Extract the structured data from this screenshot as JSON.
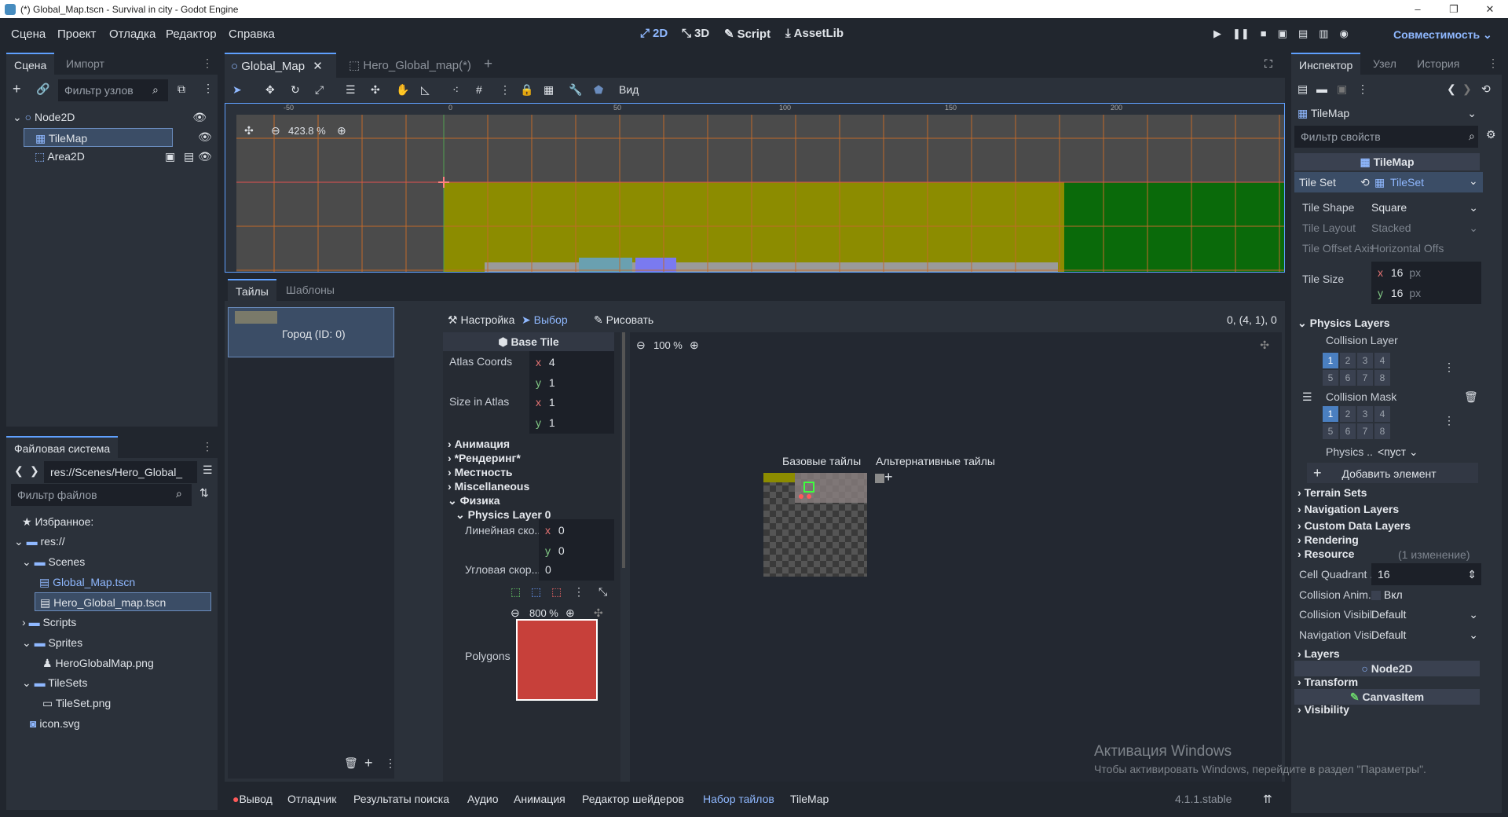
{
  "window": {
    "title": "(*) Global_Map.tscn - Survival in city - Godot Engine",
    "minimize": "–",
    "maximize": "❐",
    "close": "✕"
  },
  "menu": {
    "items": [
      "Сцена",
      "Проект",
      "Отладка",
      "Редактор",
      "Справка"
    ],
    "workspaces": [
      "2D",
      "3D",
      "Script",
      "AssetLib"
    ],
    "renderer": "Совместимость"
  },
  "scene_dock": {
    "tabs": [
      "Сцена",
      "Импорт"
    ],
    "filter_placeholder": "Фильтр узлов",
    "nodes": [
      "Node2D",
      "TileMap",
      "Area2D"
    ]
  },
  "fs_dock": {
    "title": "Файловая система",
    "path": "res://Scenes/Hero_Global_",
    "filter_placeholder": "Фильтр файлов",
    "items": [
      "Избранное:",
      "res://",
      "Scenes",
      "Global_Map.tscn",
      "Hero_Global_map.tscn",
      "Scripts",
      "Sprites",
      "HeroGlobalMap.png",
      "TileSets",
      "TileSet.png",
      "icon.svg"
    ]
  },
  "editor_tabs": [
    "Global_Map",
    "Hero_Global_map(*)"
  ],
  "toolbar": {
    "view": "Вид"
  },
  "viewport": {
    "zoom": "423.8 %",
    "ruler": [
      "-50",
      "0",
      "50",
      "100",
      "150",
      "200"
    ]
  },
  "tileset_panel": {
    "tabs": [
      "Тайлы",
      "Шаблоны"
    ],
    "source": "Город (ID: 0)",
    "modes": [
      "Настройка",
      "Выбор",
      "Рисовать"
    ],
    "coords": "0, (4, 1), 0",
    "base_tile": "Base Tile",
    "atlas_coords": "Atlas Coords",
    "atlas_x": "4",
    "atlas_y": "1",
    "size_in_atlas": "Size in Atlas",
    "size_x": "1",
    "size_y": "1",
    "sections": [
      "Анимация",
      "*Рендеринг*",
      "Местность",
      "Miscellaneous",
      "Физика"
    ],
    "physics_layer": "Physics Layer 0",
    "linear_velocity": "Линейная ско...",
    "lin_x": "0",
    "lin_y": "0",
    "angular_velocity": "Угловая скор...",
    "ang": "0",
    "poly_zoom": "800 %",
    "polygons": "Polygons",
    "atlas_zoom": "100 %",
    "base_tiles": "Базовые тайлы",
    "alt_tiles": "Альтернативные тайлы"
  },
  "bottom_bar": {
    "tabs": [
      "Вывод",
      "Отладчик",
      "Результаты поиска",
      "Аудио",
      "Анимация",
      "Редактор шейдеров",
      "Набор тайлов",
      "TileMap"
    ],
    "version": "4.1.1.stable"
  },
  "inspector": {
    "tabs": [
      "Инспектор",
      "Узел",
      "История"
    ],
    "object": "TileMap",
    "filter_placeholder": "Фильтр свойств",
    "header": "TileMap",
    "tile_set_label": "Tile Set",
    "tile_set_value": "TileSet",
    "props": [
      {
        "label": "Tile Shape",
        "value": "Square"
      },
      {
        "label": "Tile Layout",
        "value": "Stacked"
      },
      {
        "label": "Tile Offset Axis",
        "value": "Horizontal Offs"
      }
    ],
    "tile_size_label": "Tile Size",
    "tile_size_x": "16",
    "tile_size_y": "16",
    "px": "px",
    "physics_layers": "Physics Layers",
    "collision_layer": "Collision Layer",
    "collision_mask": "Collision Mask",
    "physics_material": "Physics ...",
    "physics_material_value": "<пуст",
    "layer_bits": [
      "1",
      "2",
      "3",
      "4",
      "5",
      "6",
      "7",
      "8"
    ],
    "add_element": "Добавить элемент",
    "sections": [
      "Terrain Sets",
      "Navigation Layers",
      "Custom Data Layers",
      "Rendering",
      "Resource"
    ],
    "resource_note": "(1 изменение)",
    "cell_quadrant_label": "Cell Quadrant ...",
    "cell_quadrant_value": "16",
    "collision_anim_label": "Collision Anim...",
    "collision_anim_value": "Вкл",
    "collision_vis_label": "Collision Visibil...",
    "collision_vis_value": "Default",
    "nav_vis_label": "Navigation Visi...",
    "nav_vis_value": "Default",
    "layers": "Layers",
    "node2d": "Node2D",
    "transform": "Transform",
    "canvas_item": "CanvasItem",
    "visibility": "Visibility"
  },
  "watermark": {
    "line1": "Активация Windows",
    "line2": "Чтобы активировать Windows, перейдите в раздел \"Параметры\"."
  }
}
